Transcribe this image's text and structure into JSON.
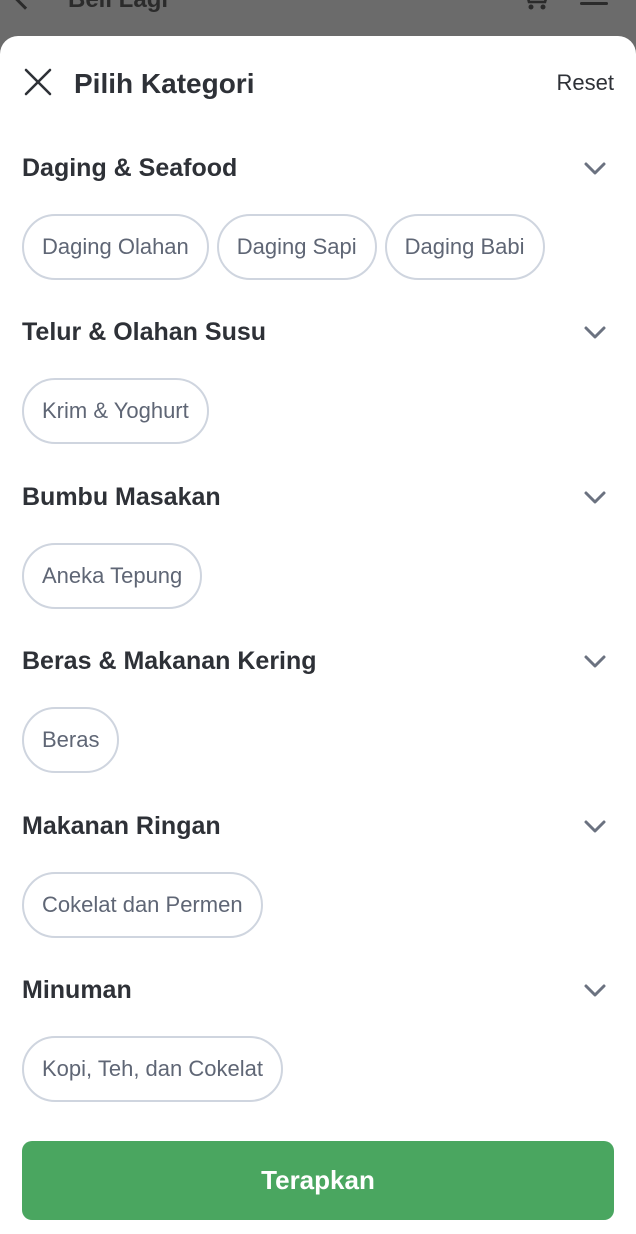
{
  "background": {
    "title": "Beli Lagi",
    "icons": [
      "back-arrow-icon",
      "cart-icon",
      "menu-icon"
    ]
  },
  "sheet": {
    "title": "Pilih Kategori",
    "reset_label": "Reset",
    "close_icon": "close-icon",
    "apply_label": "Terapkan",
    "accent_color": "#4aa660"
  },
  "sections": [
    {
      "title": "Daging & Seafood",
      "chips": [
        "Daging Olahan",
        "Daging Sapi",
        "Daging Babi"
      ]
    },
    {
      "title": "Telur & Olahan Susu",
      "chips": [
        "Krim & Yoghurt"
      ]
    },
    {
      "title": "Bumbu Masakan",
      "chips": [
        "Aneka Tepung"
      ]
    },
    {
      "title": "Beras & Makanan Kering",
      "chips": [
        "Beras"
      ]
    },
    {
      "title": "Makanan Ringan",
      "chips": [
        "Cokelat dan Permen"
      ]
    },
    {
      "title": "Minuman",
      "chips": [
        "Kopi, Teh, dan Cokelat"
      ]
    }
  ]
}
